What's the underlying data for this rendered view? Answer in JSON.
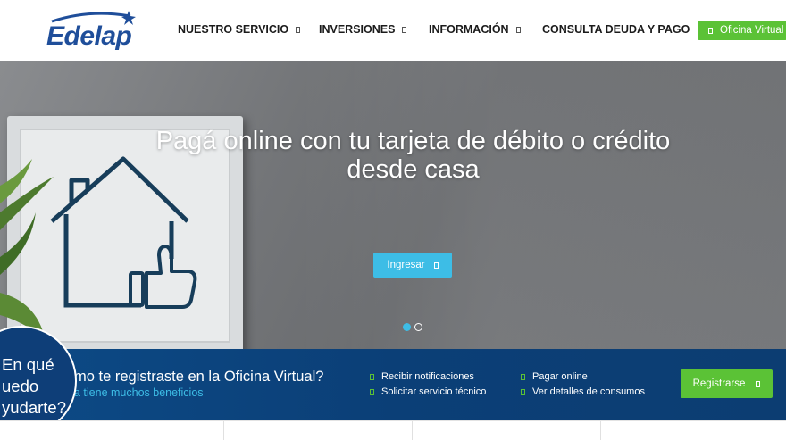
{
  "brand": {
    "name": "Edelap",
    "color": "#1f4e9a"
  },
  "nav": {
    "items": [
      {
        "label": "NUESTRO SERVICIO",
        "has_caret": true
      },
      {
        "label": "INVERSIONES",
        "has_caret": true
      },
      {
        "label": "INFORMACIÓN",
        "has_caret": true
      },
      {
        "label": "CONSULTA DEUDA Y PAGO",
        "has_caret": false
      }
    ],
    "oficina_virtual": {
      "label": "Oficina Virtual",
      "color": "#5bc236"
    }
  },
  "hero": {
    "title_line1": "Pagá online con tu tarjeta de débito o crédito",
    "title_line2": "desde casa",
    "button_label": "Ingresar",
    "button_color": "#3dbde6",
    "carousel": {
      "total": 2,
      "active": 1
    }
  },
  "register_band": {
    "title": "mo te registraste en la Oficina Virtual?",
    "subtitle": "a tiene muchos beneficios",
    "benefits": [
      "Recibir notificaciones",
      "Solicitar servicio técnico",
      "Pagar online",
      "Ver detalles de consumos"
    ],
    "button_label": "Registrarse",
    "background": "#0d4a86"
  },
  "help": {
    "line1": "En qué",
    "line2": "uedo",
    "line3": "yudarte?"
  }
}
